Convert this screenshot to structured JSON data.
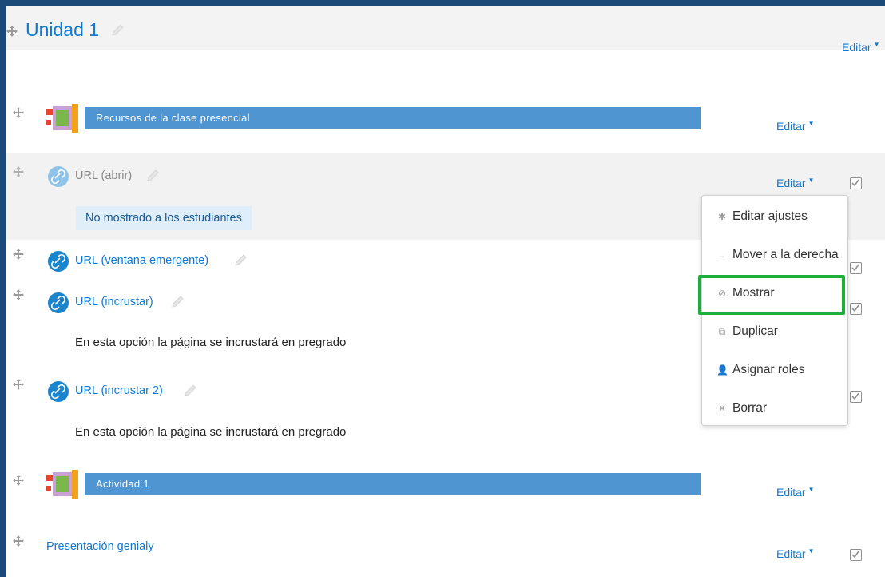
{
  "section": {
    "title": "Unidad 1",
    "edit_label": "Editar"
  },
  "items": {
    "resources_banner": {
      "text": "Recursos de la clase presencial",
      "edit_label": "Editar"
    },
    "url_open": {
      "label": "URL (abrir)",
      "edit_label": "Editar",
      "hidden_notice": "No mostrado a los estudiantes"
    },
    "url_popup": {
      "label": "URL (ventana emergente)"
    },
    "url_embed": {
      "label": "URL (incrustar)",
      "description": "En esta opción la página se incrustará en pregrado"
    },
    "url_embed2": {
      "label": "URL (incrustar 2)",
      "description": "En esta opción la página se incrustará en pregrado"
    },
    "activity_banner": {
      "text": "Actividad 1",
      "edit_label": "Editar"
    },
    "genialy": {
      "label": "Presentación genialy",
      "edit_label": "Editar"
    }
  },
  "dropdown": {
    "items": [
      {
        "label": "Editar ajustes",
        "icon": "gear-icon"
      },
      {
        "label": "Mover a la derecha",
        "icon": "arrow-right-icon"
      },
      {
        "label": "Mostrar",
        "icon": "eye-slash-icon"
      },
      {
        "label": "Duplicar",
        "icon": "duplicate-icon"
      },
      {
        "label": "Asignar roles",
        "icon": "user-plus-icon"
      },
      {
        "label": "Borrar",
        "icon": "close-icon"
      }
    ],
    "highlighted": "Mostrar"
  },
  "colors": {
    "link": "#1177d1",
    "banner": "#4f95d2",
    "highlight": "#1eae3c",
    "frame": "#1b4a78"
  }
}
